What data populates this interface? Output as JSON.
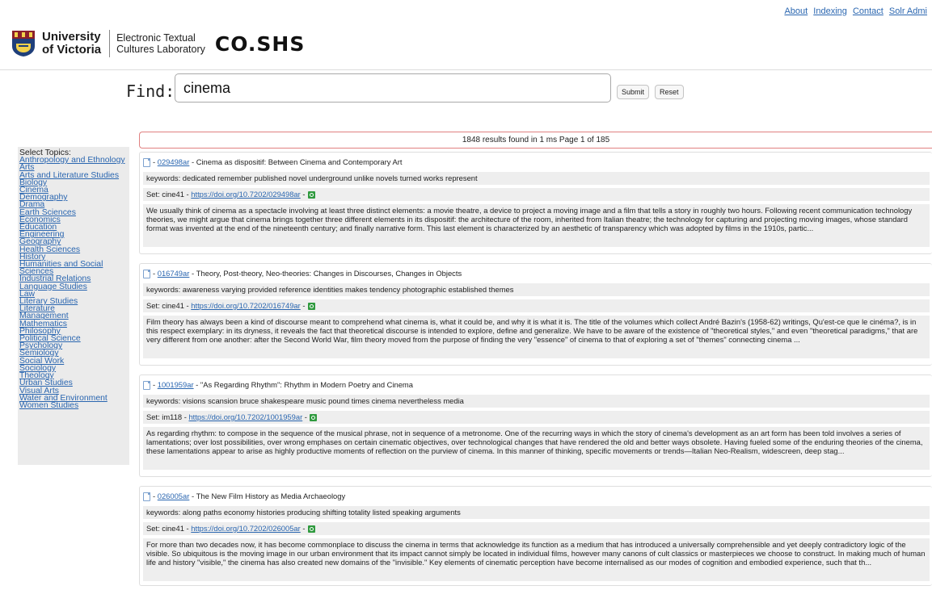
{
  "topnav": {
    "links": [
      "About",
      "Indexing",
      "Contact",
      "Solr Admi"
    ]
  },
  "header": {
    "university_line1": "University",
    "university_line2": "of Victoria",
    "lab_line1": "Electronic Textual",
    "lab_line2": "Cultures Laboratory",
    "site_name": "CO.SHS"
  },
  "search": {
    "label": "Find:",
    "value": "cinema",
    "submit_label": "Submit",
    "reset_label": "Reset"
  },
  "sidebar": {
    "title": "Select Topics:",
    "topics": [
      "Anthropology and Ethnology",
      "Arts",
      "Arts and Literature Studies",
      "Biology",
      "Cinema",
      "Demography",
      "Drama",
      "Earth Sciences",
      "Economics",
      "Education",
      "Engineering",
      "Geography",
      "Health Sciences",
      "History",
      "Humanities and Social",
      "Sciences",
      "Industrial Relations",
      "Language Studies",
      "Law",
      "Literary Studies",
      "Literature",
      "Management",
      "Mathematics",
      "Philosophy",
      "Political Science",
      "Psychology",
      "Semiology",
      "Social Work",
      "Sociology",
      "Theology",
      "Urban Studies",
      "Visual Arts",
      "Water and Environment",
      "Women Studies"
    ]
  },
  "results_summary": "1848 results found in 1 ms Page 1 of 185",
  "results": [
    {
      "id": "029498ar",
      "title": "Cinema as dispositif: Between Cinema and Contemporary Art",
      "keywords": "keywords: dedicated remember published novel underground unlike novels turned works represent",
      "set": "Set: cine41 - ",
      "doi": "https://doi.org/10.7202/029498ar",
      "abstract": "We usually think of cinema as a spectacle involving at least three distinct elements: a movie theatre, a device to project a moving image and a film that tells a story in roughly two hours. Following recent communication technology theories, we might argue that cinema brings together three different elements in its dispositif: the architecture of the room, inherited from Italian theatre; the technology for capturing and projecting moving images, whose standard format was invented at the end of the nineteenth century; and finally narrative form. This last element is characterized by an aesthetic of transparency which was adopted by films in the 1910s, partic..."
    },
    {
      "id": "016749ar",
      "title": "Theory, Post-theory, Neo-theories: Changes in Discourses, Changes in Objects",
      "keywords": "keywords: awareness varying provided reference identities makes tendency photographic established themes",
      "set": "Set: cine41 - ",
      "doi": "https://doi.org/10.7202/016749ar",
      "abstract": "Film theory has always been a kind of discourse meant to comprehend what cinema is, what it could be, and why it is what it is. The title of the volumes which collect André Bazin's (1958-62) writings, Qu'est-ce que le cinéma?, is in this respect exemplary: in its dryness, it reveals the fact that theoretical discourse is intended to explore, define and generalize. We have to be aware of the existence of \"theoretical styles,\" and even \"theoretical paradigms,\" that are very different from one another: after the Second World War, film theory moved from the purpose of finding the very \"essence\" of cinema to that of exploring a set of \"themes\" connecting cinema ..."
    },
    {
      "id": "1001959ar",
      "title": "\"As Regarding Rhythm\": Rhythm in Modern Poetry and Cinema",
      "keywords": "keywords: visions scansion bruce shakespeare music pound times cinema nevertheless media",
      "set": "Set: im118 - ",
      "doi": "https://doi.org/10.7202/1001959ar",
      "abstract": "As regarding rhythm: to compose in the sequence of the musical phrase, not in sequence of a metronome. One of the recurring ways in which the story of cinema's development as an art form has been told involves a series of lamentations; over lost possibilities, over wrong emphases on certain cinematic objectives, over technological changes that have rendered the old and better ways obsolete. Having fueled some of the enduring theories of the cinema, these lamentations appear to arise as highly productive moments of reflection on the purview of cinema. In this manner of thinking, specific movements or trends—Italian Neo-Realism, widescreen, deep stag..."
    },
    {
      "id": "026005ar",
      "title": "The New Film History as Media Archaeology",
      "keywords": "keywords: along paths economy histories producing shifting totality listed speaking arguments",
      "set": "Set: cine41 - ",
      "doi": "https://doi.org/10.7202/026005ar",
      "abstract": "For more than two decades now, it has become commonplace to discuss the cinema in terms that acknowledge its function as a medium that has introduced a universally comprehensible and yet deeply contradictory logic of the visible. So ubiquitous is the moving image in our urban environment that its impact cannot simply be located in individual films, however many canons of cult classics or masterpieces we choose to construct. In making much of human life and history \"visible,\" the cinema has also created new domains of the \"invisible.\" Key elements of cinematic perception have become internalised as our modes of cognition and embodied experience, such that th..."
    }
  ],
  "colors": {
    "link": "#2a66b0",
    "results_border": "#e08080",
    "share_icon": "#2f9a3e"
  }
}
